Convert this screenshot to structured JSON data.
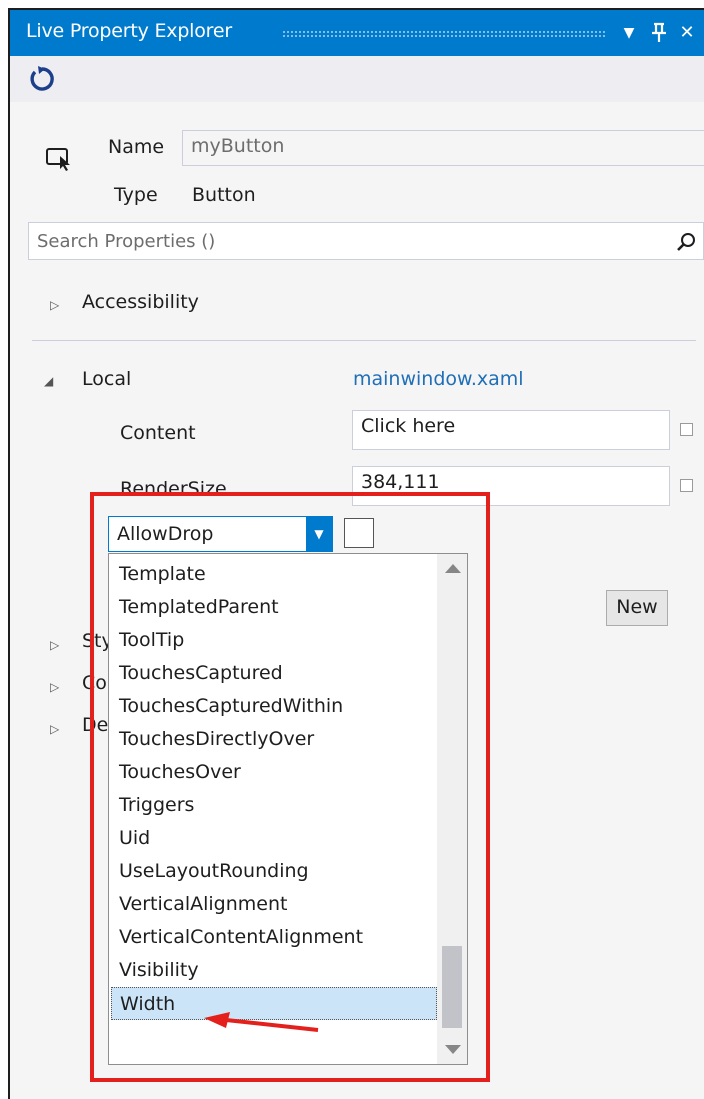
{
  "window": {
    "title": "Live Property Explorer",
    "dropdown_glyph": "▼",
    "pin_glyph": "ⵖ",
    "close_glyph": "✕"
  },
  "toolbar": {
    "refresh_icon": "refresh-icon"
  },
  "element": {
    "name_label": "Name",
    "name_value": "myButton",
    "type_label": "Type",
    "type_value": "Button"
  },
  "search": {
    "placeholder": "Search Properties ()"
  },
  "groups": {
    "accessibility": "Accessibility",
    "local": "Local",
    "local_source": "mainwindow.xaml",
    "style_partial": "Styl",
    "computed_partial": "Cor",
    "default_partial": "Def"
  },
  "properties": [
    {
      "name": "Content",
      "value": "Click here"
    },
    {
      "name": "RenderSize",
      "value": "384,111"
    }
  ],
  "new_property": {
    "selected": "AllowDrop",
    "new_button": "New"
  },
  "dropdown_list": [
    "Template",
    "TemplatedParent",
    "ToolTip",
    "TouchesCaptured",
    "TouchesCapturedWithin",
    "TouchesDirectlyOver",
    "TouchesOver",
    "Triggers",
    "Uid",
    "UseLayoutRounding",
    "VerticalAlignment",
    "VerticalContentAlignment",
    "Visibility",
    "Width"
  ],
  "highlighted_item": "Width",
  "colors": {
    "accent": "#007acc",
    "annotation": "#e3201b",
    "selection": "#cce4f7",
    "link": "#1e6fb7"
  }
}
